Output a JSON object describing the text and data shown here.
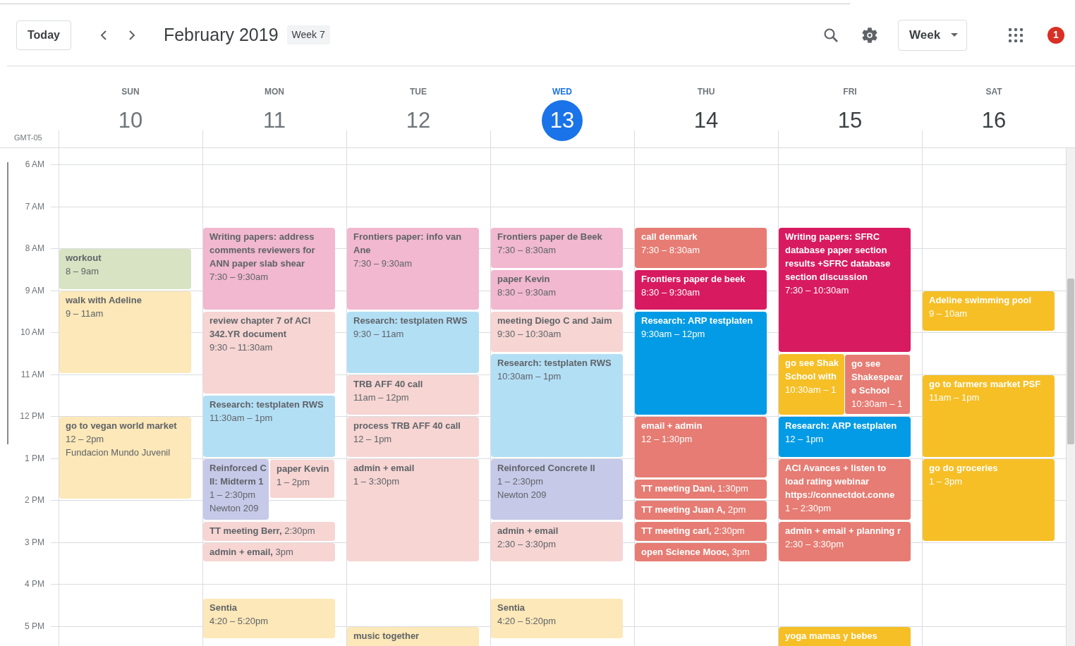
{
  "toolbar": {
    "today_button": "Today",
    "title": "February 2019",
    "week_badge": "Week 7",
    "view_selector": "Week",
    "notification_count": "1"
  },
  "timezone": "GMT-05",
  "hours": [
    "6 AM",
    "7 AM",
    "8 AM",
    "9 AM",
    "10 AM",
    "11 AM",
    "12 PM",
    "1 PM",
    "2 PM",
    "3 PM",
    "4 PM",
    "5 PM"
  ],
  "days": [
    {
      "weekday": "SUN",
      "date": "10",
      "selected": false,
      "past": true,
      "events": [
        {
          "kind": "block",
          "color": "#d7e3c2",
          "title_lines": [
            "workout"
          ],
          "time": "8 – 9am"
        },
        {
          "kind": "block",
          "color": "#fce8b8",
          "title_lines": [
            "walk with Adeline"
          ],
          "time": "9 – 11am"
        },
        {
          "kind": "block",
          "color": "#fce8b8",
          "title_lines": [
            "go to vegan world market"
          ],
          "time": "12 – 2pm",
          "location": "Fundacion Mundo Juvenil"
        }
      ]
    },
    {
      "weekday": "MON",
      "date": "11",
      "selected": false,
      "past": true,
      "events": [
        {
          "kind": "block",
          "color": "#f1b8cf",
          "title_lines": [
            "Writing papers: address",
            "comments reviewers for",
            "ANN paper slab shear"
          ],
          "time": "7:30 – 9:30am"
        },
        {
          "kind": "block",
          "color": "#f6d5d3",
          "title_lines": [
            "review chapter 7 of ACI",
            "342.YR document"
          ],
          "time": "9:30 – 11:30am"
        },
        {
          "kind": "block",
          "color": "#b3dff5",
          "title_lines": [
            "Research: testplaten RWS"
          ],
          "time": "11:30am – 1pm"
        },
        {
          "kind": "block",
          "color": "#c7c9e8",
          "title_lines": [
            "Reinforced C",
            "II: Midterm 1"
          ],
          "time": "1 – 2:30pm",
          "location": "Newton 209"
        },
        {
          "kind": "block",
          "color": "#f6d5d3",
          "title_lines": [
            "paper Kevin"
          ],
          "time": "1 – 2pm"
        },
        {
          "kind": "compact",
          "color": "#f6d5d3",
          "title_lines": [
            "TT meeting Berr,"
          ],
          "time": "2:30pm"
        },
        {
          "kind": "compact",
          "color": "#f6d5d3",
          "title_lines": [
            "admin + email,"
          ],
          "time": "3pm"
        },
        {
          "kind": "block",
          "color": "#fce8b8",
          "title_lines": [
            "Sentia"
          ],
          "time": "4:20 – 5:20pm"
        }
      ]
    },
    {
      "weekday": "TUE",
      "date": "12",
      "selected": false,
      "past": true,
      "events": [
        {
          "kind": "block",
          "color": "#f1b8cf",
          "title_lines": [
            "Frontiers paper: info van",
            "Ane"
          ],
          "time": "7:30 – 9:30am"
        },
        {
          "kind": "block",
          "color": "#b3dff5",
          "title_lines": [
            "Research: testplaten RWS"
          ],
          "time": "9:30 – 11am"
        },
        {
          "kind": "block",
          "color": "#f6d5d3",
          "title_lines": [
            "TRB AFF 40 call"
          ],
          "time": "11am – 12pm"
        },
        {
          "kind": "block",
          "color": "#f6d5d3",
          "title_lines": [
            "process TRB AFF 40 call"
          ],
          "time": "12 – 1pm"
        },
        {
          "kind": "block",
          "color": "#f6d5d3",
          "title_lines": [
            "admin + email"
          ],
          "time": "1 – 3:30pm"
        },
        {
          "kind": "block",
          "color": "#fce8b8",
          "title_lines": [
            "music together"
          ]
        }
      ]
    },
    {
      "weekday": "WED",
      "date": "13",
      "selected": true,
      "past": false,
      "events": [
        {
          "kind": "block",
          "color": "#f1b8cf",
          "title_lines": [
            "Frontiers paper de Beek"
          ],
          "time": "7:30 – 8:30am"
        },
        {
          "kind": "block",
          "color": "#f1b8cf",
          "title_lines": [
            "paper Kevin"
          ],
          "time": "8:30 – 9:30am"
        },
        {
          "kind": "block",
          "color": "#f6d5d3",
          "title_lines": [
            "meeting Diego C and Jaim"
          ],
          "time": "9:30 – 10:30am"
        },
        {
          "kind": "block",
          "color": "#b3dff5",
          "title_lines": [
            "Research: testplaten RWS"
          ],
          "time": "10:30am – 1pm"
        },
        {
          "kind": "block",
          "color": "#c7c9e8",
          "title_lines": [
            "Reinforced Concrete II"
          ],
          "time": "1 – 2:30pm",
          "location": "Newton 209"
        },
        {
          "kind": "block",
          "color": "#f6d5d3",
          "title_lines": [
            "admin + email"
          ],
          "time": "2:30 – 3:30pm"
        },
        {
          "kind": "block",
          "color": "#fce8b8",
          "title_lines": [
            "Sentia"
          ],
          "time": "4:20 – 5:20pm"
        }
      ]
    },
    {
      "weekday": "THU",
      "date": "14",
      "selected": false,
      "past": false,
      "events": [
        {
          "kind": "block",
          "color": "#e67c73",
          "title_lines": [
            "call denmark"
          ],
          "time": "7:30 – 8:30am"
        },
        {
          "kind": "block",
          "color": "#d81b60",
          "title_lines": [
            "Frontiers paper de beek"
          ],
          "time": "8:30 – 9:30am"
        },
        {
          "kind": "block",
          "color": "#039be5",
          "title_lines": [
            "Research: ARP testplaten"
          ],
          "time": "9:30am – 12pm"
        },
        {
          "kind": "block",
          "color": "#e67c73",
          "title_lines": [
            "email + admin"
          ],
          "time": "12 – 1:30pm"
        },
        {
          "kind": "compact",
          "color": "#e67c73",
          "title_lines": [
            "TT meeting Dani,"
          ],
          "time": "1:30pm"
        },
        {
          "kind": "compact",
          "color": "#e67c73",
          "title_lines": [
            "TT meeting Juan A,"
          ],
          "time": "2pm"
        },
        {
          "kind": "compact",
          "color": "#e67c73",
          "title_lines": [
            "TT meeting carl,"
          ],
          "time": "2:30pm"
        },
        {
          "kind": "compact",
          "color": "#e67c73",
          "title_lines": [
            "open Science Mooc,"
          ],
          "time": "3pm"
        }
      ]
    },
    {
      "weekday": "FRI",
      "date": "15",
      "selected": false,
      "past": false,
      "events": [
        {
          "kind": "block",
          "color": "#d81b60",
          "title_lines": [
            "Writing papers: SFRC",
            "database paper section",
            "results +SFRC database",
            "section discussion"
          ],
          "time": "7:30 – 10:30am"
        },
        {
          "kind": "block",
          "color": "#f6bf26",
          "title_lines": [
            "go see Shak",
            "School with"
          ],
          "time": "10:30am – 1"
        },
        {
          "kind": "block",
          "color": "#e67c73",
          "title_lines": [
            "go see",
            "Shakespear",
            "e School"
          ],
          "time": "10:30am – 1"
        },
        {
          "kind": "block",
          "color": "#039be5",
          "title_lines": [
            "Research: ARP testplaten"
          ],
          "time": "12 – 1pm"
        },
        {
          "kind": "block",
          "color": "#e67c73",
          "title_lines": [
            "ACI Avances + listen to",
            "load rating webinar",
            "https://connectdot.conne"
          ],
          "time": "1 – 2:30pm"
        },
        {
          "kind": "block",
          "color": "#e67c73",
          "title_lines": [
            "admin + email + planning r"
          ],
          "time": "2:30 – 3:30pm"
        },
        {
          "kind": "block",
          "color": "#f6bf26",
          "title_lines": [
            "yoga mamas y bebes"
          ]
        }
      ]
    },
    {
      "weekday": "SAT",
      "date": "16",
      "selected": false,
      "past": false,
      "events": [
        {
          "kind": "block",
          "color": "#f6bf26",
          "title_lines": [
            "Adeline swimming pool"
          ],
          "time": "9 – 10am"
        },
        {
          "kind": "block",
          "color": "#f6bf26",
          "title_lines": [
            "go to farmers market PSF"
          ],
          "time": "11am – 1pm"
        },
        {
          "kind": "block",
          "color": "#f6bf26",
          "title_lines": [
            "go do groceries"
          ],
          "time": "1 – 3pm"
        }
      ]
    }
  ]
}
